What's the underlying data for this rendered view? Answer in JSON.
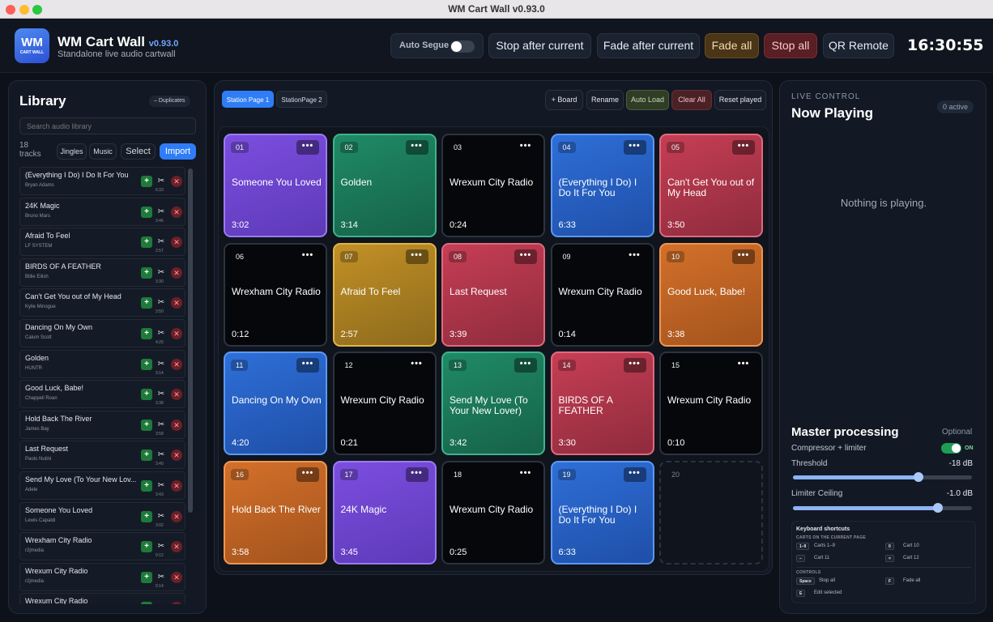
{
  "window": {
    "title": "WM Cart Wall v0.93.0"
  },
  "header": {
    "logo_big": "WM",
    "logo_small": "CART WALL",
    "app_name": "WM Cart Wall",
    "version": "v0.93.0",
    "subtitle": "Standalone live audio cartwall",
    "auto_segue": "Auto Segue",
    "stop_after": "Stop after current",
    "fade_after": "Fade after current",
    "fade_all": "Fade all",
    "stop_all": "Stop all",
    "qr_remote": "QR Remote",
    "clock": "16:30:55"
  },
  "library": {
    "title": "Library",
    "duplicates": "– Duplicates",
    "search_placeholder": "Search audio library",
    "track_count": "18 tracks",
    "filter_jingles": "Jingles",
    "filter_music": "Music",
    "select": "Select",
    "import": "Import",
    "tracks": [
      {
        "title": "(Everything I Do) I Do It For You",
        "artist": "Bryan Adams",
        "dur": "6:33"
      },
      {
        "title": "24K Magic",
        "artist": "Bruno Mars",
        "dur": "3:46"
      },
      {
        "title": "Afraid To Feel",
        "artist": "LF SYSTEM",
        "dur": "2:57"
      },
      {
        "title": "BIRDS OF A FEATHER",
        "artist": "Billie Eilish",
        "dur": "3:30"
      },
      {
        "title": "Can't Get You out of My Head",
        "artist": "Kylie Minogue",
        "dur": "3:50"
      },
      {
        "title": "Dancing On My Own",
        "artist": "Calum Scott",
        "dur": "4:20"
      },
      {
        "title": "Golden",
        "artist": "HUNTR",
        "dur": "3:14"
      },
      {
        "title": "Good Luck, Babe!",
        "artist": "Chappell Roan",
        "dur": "3:38"
      },
      {
        "title": "Hold Back The River",
        "artist": "James Bay",
        "dur": "3:58"
      },
      {
        "title": "Last Request",
        "artist": "Paolo Nutini",
        "dur": "3:40"
      },
      {
        "title": "Send My Love (To Your New Lov...",
        "artist": "Adele",
        "dur": "3:43"
      },
      {
        "title": "Someone You Loved",
        "artist": "Lewis Capaldi",
        "dur": "3:02"
      },
      {
        "title": "Wrexham City Radio",
        "artist": "r2jmedia",
        "dur": "0:12"
      },
      {
        "title": "Wrexum City Radio",
        "artist": "r2jmedia",
        "dur": "0:14"
      },
      {
        "title": "Wrexum City Radio",
        "artist": "",
        "dur": ""
      }
    ]
  },
  "pages": {
    "tabs": [
      "Station Page 1",
      "StationPage 2"
    ],
    "board": "+ Board",
    "rename": "Rename",
    "auto_load": "Auto Load",
    "clear_all": "Clear All",
    "reset_played": "Reset played"
  },
  "carts": [
    {
      "num": "01",
      "title": "Someone You Loved",
      "dur": "3:02",
      "color": "purple"
    },
    {
      "num": "02",
      "title": "Golden",
      "dur": "3:14",
      "color": "green"
    },
    {
      "num": "03",
      "title": "Wrexum City Radio",
      "dur": "0:24",
      "color": "black"
    },
    {
      "num": "04",
      "title": "(Everything I Do) I Do It For You",
      "dur": "6:33",
      "color": "blue"
    },
    {
      "num": "05",
      "title": "Can't Get You out of My Head",
      "dur": "3:50",
      "color": "red"
    },
    {
      "num": "06",
      "title": "Wrexham City Radio",
      "dur": "0:12",
      "color": "black"
    },
    {
      "num": "07",
      "title": "Afraid To Feel",
      "dur": "2:57",
      "color": "gold"
    },
    {
      "num": "08",
      "title": "Last Request",
      "dur": "3:39",
      "color": "red"
    },
    {
      "num": "09",
      "title": "Wrexum City Radio",
      "dur": "0:14",
      "color": "black"
    },
    {
      "num": "10",
      "title": "Good Luck, Babe!",
      "dur": "3:38",
      "color": "orange"
    },
    {
      "num": "11",
      "title": "Dancing On My Own",
      "dur": "4:20",
      "color": "blue"
    },
    {
      "num": "12",
      "title": "Wrexum City Radio",
      "dur": "0:21",
      "color": "black"
    },
    {
      "num": "13",
      "title": "Send My Love (To Your New Lover)",
      "dur": "3:42",
      "color": "green"
    },
    {
      "num": "14",
      "title": "BIRDS OF A FEATHER",
      "dur": "3:30",
      "color": "red"
    },
    {
      "num": "15",
      "title": "Wrexum City Radio",
      "dur": "0:10",
      "color": "black"
    },
    {
      "num": "16",
      "title": "Hold Back The River",
      "dur": "3:58",
      "color": "orange"
    },
    {
      "num": "17",
      "title": "24K Magic",
      "dur": "3:45",
      "color": "purple"
    },
    {
      "num": "18",
      "title": "Wrexum City Radio",
      "dur": "0:25",
      "color": "black"
    },
    {
      "num": "19",
      "title": "(Everything I Do) I Do It For You",
      "dur": "6:33",
      "color": "blue"
    },
    {
      "num": "20",
      "title": "",
      "dur": "",
      "color": "empty"
    }
  ],
  "live": {
    "label": "LIVE CONTROL",
    "title": "Now Playing",
    "active": "0 active",
    "nothing": "Nothing is playing.",
    "master": "Master processing",
    "optional": "Optional",
    "compressor": "Compressor + limiter",
    "on": "ON",
    "threshold_label": "Threshold",
    "threshold_value": "-18 dB",
    "threshold_level": 0.7,
    "ceiling_label": "Limiter Ceiling",
    "ceiling_value": "-1.0 dB",
    "ceiling_level": 0.81
  },
  "shortcuts": {
    "title": "Keyboard shortcuts",
    "section_carts": "CARTS ON THE CURRENT PAGE",
    "section_controls": "CONTROLS",
    "items": [
      {
        "key": "1–9",
        "desc": "Carts 1–9"
      },
      {
        "key": "0",
        "desc": "Cart 10"
      },
      {
        "key": "–",
        "desc": "Cart 11"
      },
      {
        "key": "=",
        "desc": "Cart 12"
      },
      {
        "key": "Space",
        "desc": "Stop all"
      },
      {
        "key": "F",
        "desc": "Fade all"
      },
      {
        "key": "E",
        "desc": "Edit selected"
      }
    ]
  }
}
